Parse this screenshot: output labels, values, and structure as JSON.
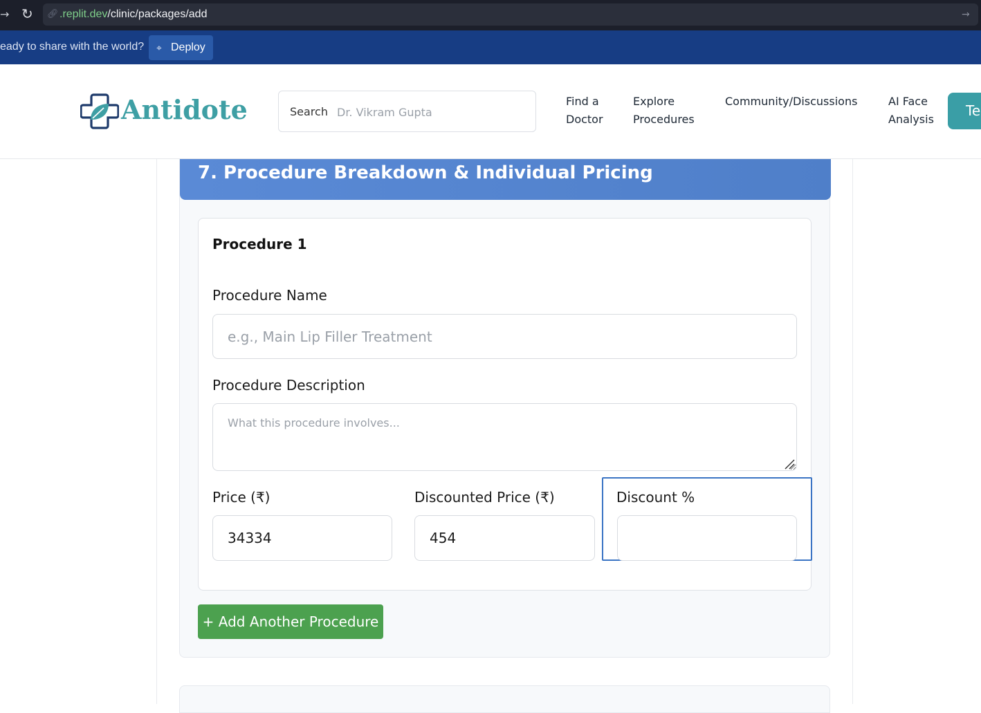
{
  "browser": {
    "url_domain": ".replit.dev",
    "url_path": "/clinic/packages/add"
  },
  "deploy_banner": {
    "message": "eady to share with the world?",
    "button_label": "Deploy"
  },
  "header": {
    "logo_text": "Antidote",
    "search_label": "Search",
    "search_placeholder": "Dr. Vikram Gupta",
    "nav": {
      "find_doctor": "Find a Doctor",
      "explore_procedures": "Explore Procedures",
      "community": "Community/Discussions",
      "ai_face": "AI Face Analysis"
    },
    "cta_label": "Te"
  },
  "section": {
    "title": "7. Procedure Breakdown & Individual Pricing",
    "procedure": {
      "heading": "Procedure 1",
      "name_label": "Procedure Name",
      "name_placeholder": "e.g., Main Lip Filler Treatment",
      "description_label": "Procedure Description",
      "description_placeholder": "What this procedure involves...",
      "price_label": "Price (₹)",
      "price_value": "34334",
      "discounted_price_label": "Discounted Price (₹)",
      "discounted_price_value": "454",
      "discount_pct_label": "Discount %",
      "discount_pct_value": ""
    },
    "add_button": "+ Add Another Procedure"
  },
  "colors": {
    "brand_teal": "#3e9fa4",
    "brand_navy": "#1d3a6b",
    "section_header_blue": "#5a8ad6",
    "add_button_green": "#4ca14f",
    "focus_blue": "#3b74c4",
    "banner_blue": "#173d84"
  }
}
